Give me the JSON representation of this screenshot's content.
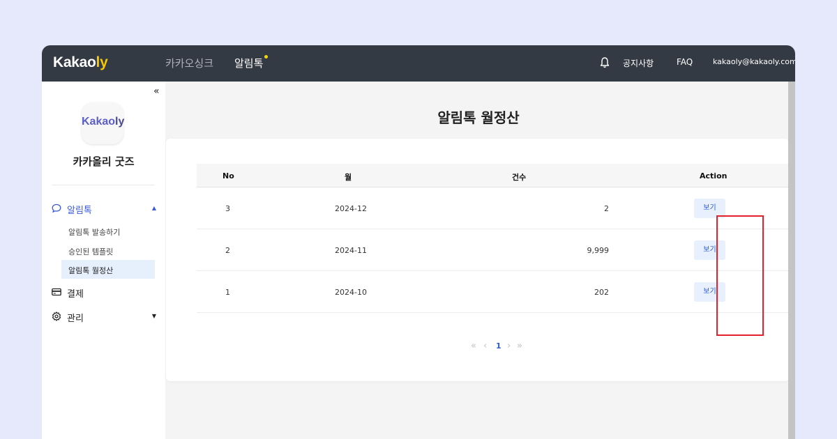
{
  "topbar": {
    "logo_main": "Kakao",
    "logo_accent": "ly",
    "nav": [
      "카카오싱크",
      "알림톡"
    ],
    "notice": "공지사항",
    "faq": "FAQ",
    "email": "kakaoly@kakaoly.com",
    "bell_icon": "bell-icon"
  },
  "sidebar": {
    "collapse": "«",
    "brand_logo_main": "Kakao",
    "brand_logo_accent": "ly",
    "brand_name": "카카올리 굿즈",
    "menu": {
      "talk": "알림톡",
      "talk_sub": [
        "알림톡 발송하기",
        "승인된 템플릿",
        "알림톡 월정산"
      ],
      "payment": "결제",
      "admin": "관리"
    }
  },
  "main": {
    "title": "알림톡 월정산",
    "table": {
      "headers": [
        "No",
        "월",
        "건수",
        "Action"
      ],
      "rows": [
        {
          "no": "3",
          "month": "2024-12",
          "count": "2",
          "action": "보기"
        },
        {
          "no": "2",
          "month": "2024-11",
          "count": "9,999",
          "action": "보기"
        },
        {
          "no": "1",
          "month": "2024-10",
          "count": "202",
          "action": "보기"
        }
      ]
    },
    "pagination": {
      "first": "«",
      "prev": "‹",
      "current": "1",
      "next": "›",
      "last": "»"
    }
  },
  "colors": {
    "accent": "#3b5bdb",
    "highlight": "#e3212b",
    "topbar": "#343a44",
    "logo_accent": "#f5c800"
  }
}
